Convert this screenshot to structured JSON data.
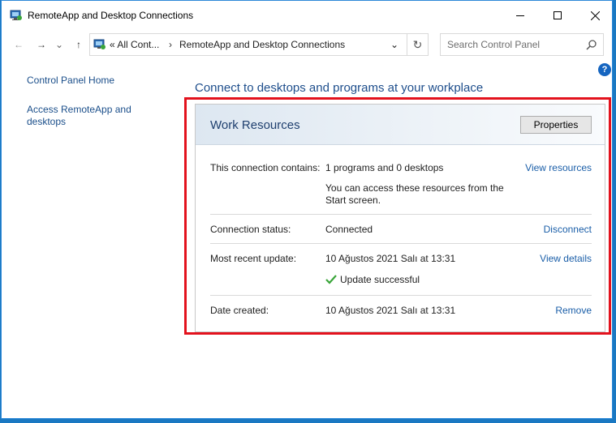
{
  "window": {
    "title": "RemoteApp and Desktop Connections"
  },
  "address": {
    "crumb1": "« All Cont...",
    "separator": "›",
    "crumb2": "RemoteApp and Desktop Connections"
  },
  "search": {
    "placeholder": "Search Control Panel"
  },
  "left_nav": {
    "home": "Control Panel Home",
    "access": "Access RemoteApp and desktops"
  },
  "heading": "Connect to desktops and programs at your workplace",
  "panel": {
    "title": "Work Resources",
    "properties_label": "Properties",
    "rows": {
      "contains": {
        "label": "This connection contains:",
        "value": "1 programs and 0 desktops",
        "note": "You can access these resources from the Start screen.",
        "link": "View resources"
      },
      "status": {
        "label": "Connection status:",
        "value": "Connected",
        "link": "Disconnect"
      },
      "update": {
        "label": "Most recent update:",
        "value": "10 Ağustos 2021 Salı at 13:31",
        "success": "Update successful",
        "link": "View details"
      },
      "created": {
        "label": "Date created:",
        "value": "10 Ağustos 2021 Salı at 13:31",
        "link": "Remove"
      }
    }
  },
  "icons": {
    "help": "?",
    "back": "←",
    "forward": "→",
    "recent": "⌄",
    "up": "↑",
    "dropdown": "⌄",
    "refresh": "↻"
  },
  "colors": {
    "accent": "#1a78c2",
    "highlight_border": "#e3121d",
    "link": "#1a5ea8",
    "success_check": "#3aa53a"
  }
}
